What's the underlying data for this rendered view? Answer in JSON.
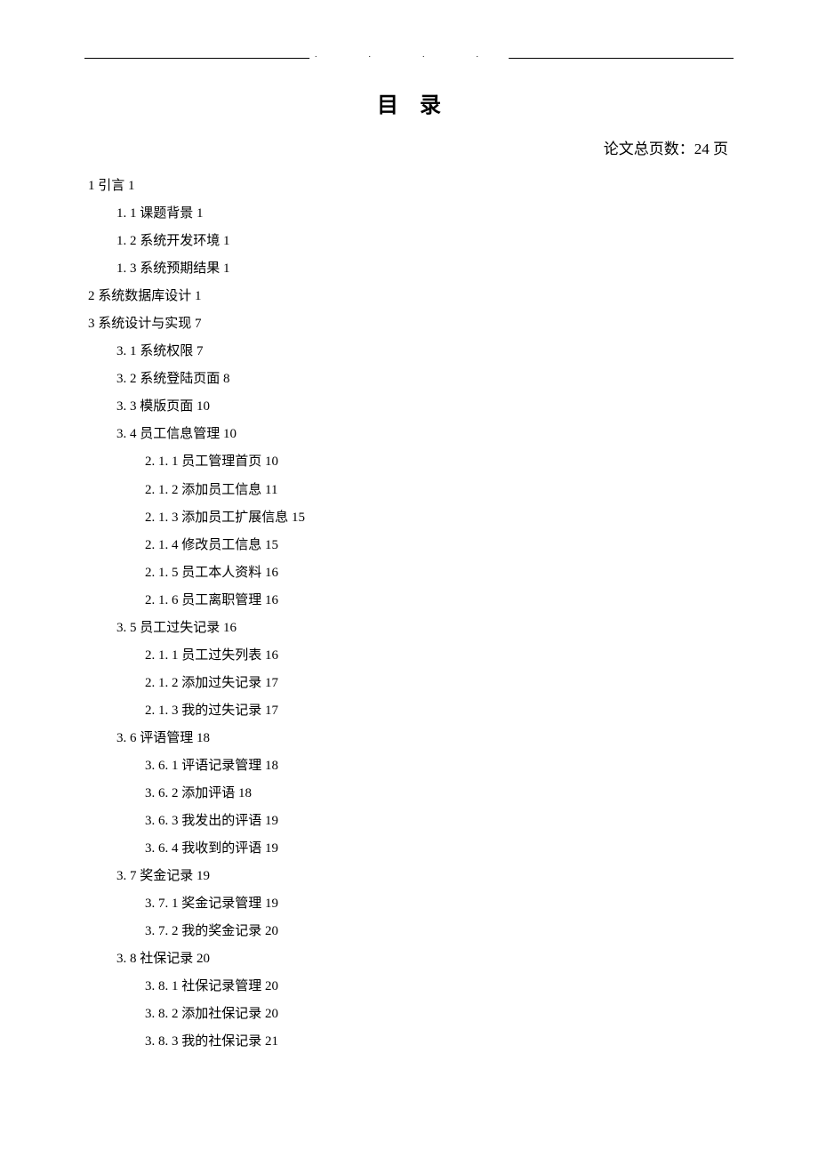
{
  "title": "目录",
  "total_pages_label": "论文总页数：24 页",
  "toc": [
    {
      "level": 0,
      "text": "1 引言 1"
    },
    {
      "level": 1,
      "text": "1. 1 课题背景 1"
    },
    {
      "level": 1,
      "text": "1. 2 系统开发环境 1"
    },
    {
      "level": 1,
      "text": "1. 3 系统预期结果 1"
    },
    {
      "level": 0,
      "text": "2 系统数据库设计 1"
    },
    {
      "level": 0,
      "text": "3 系统设计与实现 7"
    },
    {
      "level": 1,
      "text": "3. 1 系统权限 7"
    },
    {
      "level": 1,
      "text": "3. 2 系统登陆页面 8"
    },
    {
      "level": 1,
      "text": "3. 3 模版页面 10"
    },
    {
      "level": 1,
      "text": "3. 4 员工信息管理 10"
    },
    {
      "level": 2,
      "text": "2. 1. 1 员工管理首页 10"
    },
    {
      "level": 2,
      "text": "2. 1. 2 添加员工信息 11"
    },
    {
      "level": 2,
      "text": "2. 1. 3 添加员工扩展信息 15"
    },
    {
      "level": 2,
      "text": "2. 1. 4 修改员工信息 15"
    },
    {
      "level": 2,
      "text": "2. 1. 5 员工本人资料 16"
    },
    {
      "level": 2,
      "text": "2. 1. 6 员工离职管理 16"
    },
    {
      "level": 1,
      "text": "3. 5 员工过失记录 16"
    },
    {
      "level": 2,
      "text": "2. 1. 1 员工过失列表 16"
    },
    {
      "level": 2,
      "text": "2. 1. 2 添加过失记录 17"
    },
    {
      "level": 2,
      "text": "2. 1. 3 我的过失记录 17"
    },
    {
      "level": 1,
      "text": "3. 6 评语管理 18"
    },
    {
      "level": 2,
      "text": "3. 6. 1 评语记录管理 18"
    },
    {
      "level": 2,
      "text": "3. 6. 2 添加评语 18"
    },
    {
      "level": 2,
      "text": "3. 6. 3 我发出的评语 19"
    },
    {
      "level": 2,
      "text": "3. 6. 4 我收到的评语 19"
    },
    {
      "level": 1,
      "text": "3. 7 奖金记录 19"
    },
    {
      "level": 2,
      "text": "3. 7. 1 奖金记录管理 19"
    },
    {
      "level": 2,
      "text": "3. 7. 2 我的奖金记录 20"
    },
    {
      "level": 1,
      "text": "3. 8 社保记录 20"
    },
    {
      "level": 2,
      "text": "3. 8. 1 社保记录管理 20"
    },
    {
      "level": 2,
      "text": "3. 8. 2 添加社保记录 20"
    },
    {
      "level": 2,
      "text": "3. 8. 3 我的社保记录 21"
    }
  ]
}
